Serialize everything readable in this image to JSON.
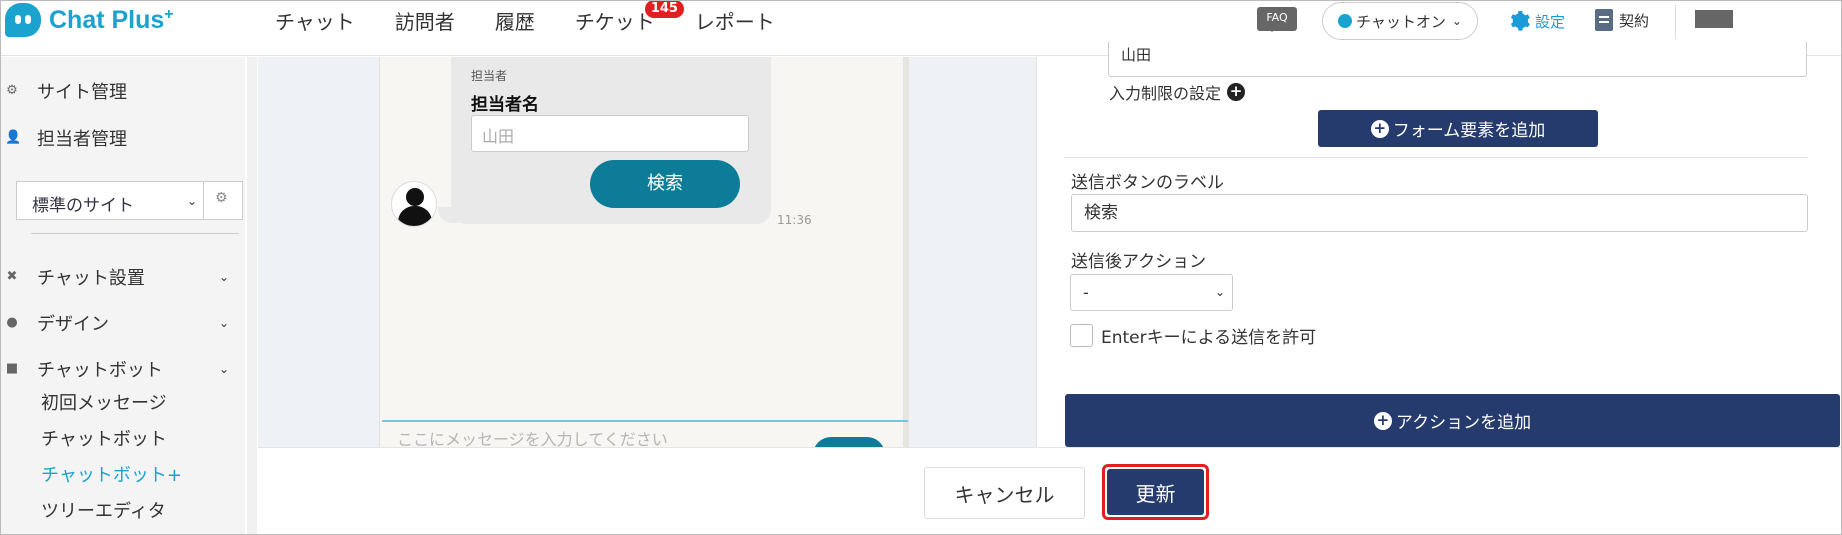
{
  "header": {
    "logo_text": "Chat Plus",
    "logo_plus": "+",
    "nav": [
      "チャット",
      "訪問者",
      "履歴",
      "チケット",
      "レポート"
    ],
    "ticket_badge": "145",
    "faq": "FAQ",
    "status": "チャットオン",
    "settings": "設定",
    "contract": "契約"
  },
  "sidebar": {
    "site_admin": "サイト管理",
    "staff_admin": "担当者管理",
    "site_select": "標準のサイト",
    "chat_setup": "チャット設置",
    "design": "デザイン",
    "chatbot": "チャットボット",
    "sub_items": [
      "初回メッセージ",
      "チャットボット",
      "チャットボット+",
      "ツリーエディタ"
    ]
  },
  "preview": {
    "agent_tag": "担当者",
    "agent_label": "担当者名",
    "agent_placeholder": "山田",
    "search_button": "検索",
    "time": "11:36",
    "message_placeholder": "ここにメッセージを入力してください"
  },
  "form": {
    "top_field_value": "山田",
    "input_restriction": "入力制限の設定",
    "add_form_element": "フォーム要素を追加",
    "send_button_label_title": "送信ボタンのラベル",
    "send_button_label_value": "検索",
    "after_send_action_title": "送信後アクション",
    "after_send_action_value": "-",
    "enter_key_label": "Enterキーによる送信を許可",
    "add_action": "アクションを追加"
  },
  "footer": {
    "cancel": "キャンセル",
    "update": "更新"
  },
  "colors": {
    "brand": "#1aa3cf",
    "navy": "#253a6d",
    "teal_button": "#0c7c98",
    "badge_red": "#e02020"
  }
}
